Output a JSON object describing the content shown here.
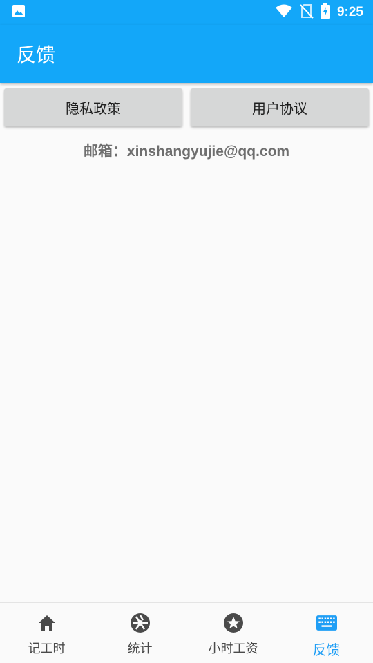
{
  "status_bar": {
    "time": "9:25",
    "icons": [
      "image-icon",
      "wifi-icon",
      "no-sim-icon",
      "battery-charging-icon"
    ]
  },
  "app_bar": {
    "title": "反馈"
  },
  "buttons": {
    "privacy_label": "隐私政策",
    "agreement_label": "用户协议"
  },
  "contact": {
    "email_text": "邮箱：xinshangyujie@qq.com"
  },
  "bottom_nav": {
    "items": [
      {
        "label": "记工时",
        "icon": "home-icon",
        "active": false
      },
      {
        "label": "统计",
        "icon": "aperture-icon",
        "active": false
      },
      {
        "label": "小时工资",
        "icon": "star-circle-icon",
        "active": false
      },
      {
        "label": "反馈",
        "icon": "keyboard-icon",
        "active": true
      }
    ]
  },
  "colors": {
    "primary": "#13a7f9",
    "active_nav": "#1f9ef5",
    "button_bg": "#d6d7d7",
    "email_text": "#6e6e6e"
  }
}
